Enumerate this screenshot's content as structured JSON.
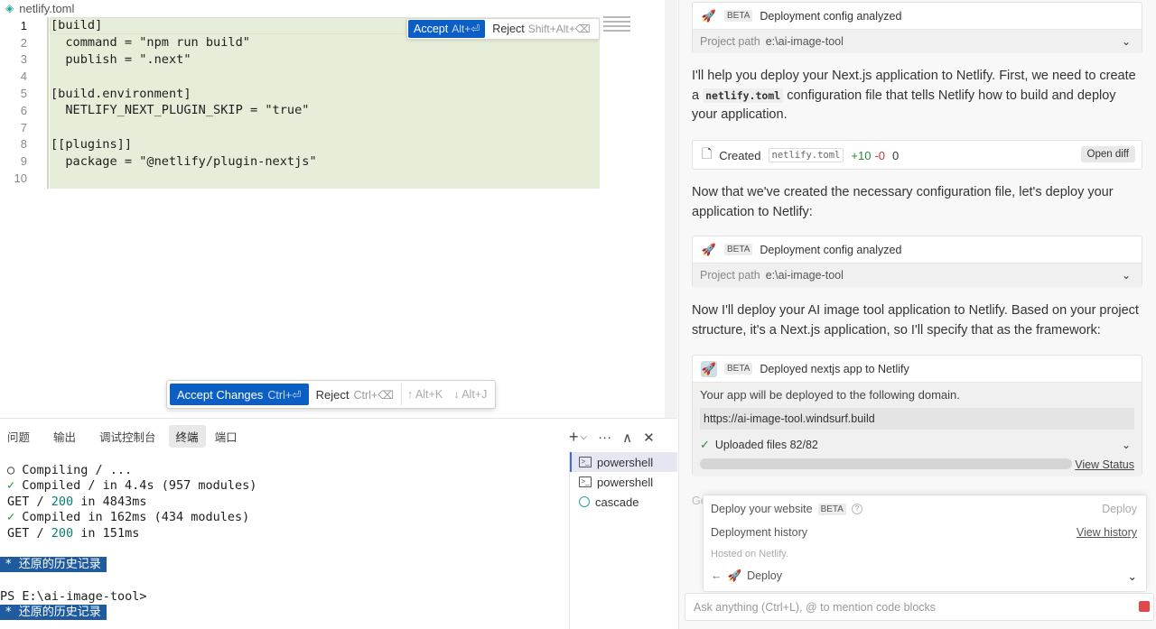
{
  "editor": {
    "filename": "netlify.toml",
    "lines": [
      {
        "num": "1",
        "text": "[build]"
      },
      {
        "num": "2",
        "text": "  command = \"npm run build\""
      },
      {
        "num": "3",
        "text": "  publish = \".next\""
      },
      {
        "num": "4",
        "text": ""
      },
      {
        "num": "5",
        "text": "[build.environment]"
      },
      {
        "num": "6",
        "text": "  NETLIFY_NEXT_PLUGIN_SKIP = \"true\""
      },
      {
        "num": "7",
        "text": ""
      },
      {
        "num": "8",
        "text": "[[plugins]]"
      },
      {
        "num": "9",
        "text": "  package = \"@netlify/plugin-nextjs\""
      },
      {
        "num": "10",
        "text": ""
      }
    ],
    "inline_accept": "Accept",
    "inline_accept_kb": "Alt+⏎",
    "inline_reject": "Reject",
    "inline_reject_kb": "Shift+Alt+⌫",
    "accept_changes": "Accept Changes",
    "accept_changes_kb": "Ctrl+⏎",
    "reject": "Reject",
    "reject_kb": "Ctrl+⌫",
    "prev_kb": "↑ Alt+K",
    "next_kb": "↓ Alt+J"
  },
  "panel": {
    "tabs": [
      "问题",
      "输出",
      "调试控制台",
      "终端",
      "端口"
    ],
    "active_tab": "终端",
    "actions": {
      "add": "+",
      "split": "⌵",
      "more": "···",
      "maximize": "∧",
      "close": "✕"
    },
    "terminal_lines": [
      {
        "prefix": "○",
        "text": " Compiling / ..."
      },
      {
        "prefix": "✓",
        "text": " Compiled / in 4.4s (957 modules)"
      },
      {
        "get": "GET / ",
        "code": "200",
        "rest": " in 4843ms"
      },
      {
        "prefix": "✓",
        "text": " Compiled in 162ms (434 modules)"
      },
      {
        "get": "GET / ",
        "code": "200",
        "rest": " in 151ms"
      }
    ],
    "history_label": "*  还原的历史记录",
    "prompt": "PS E:\\ai-image-tool>",
    "terminals": [
      "powershell",
      "powershell",
      "cascade"
    ]
  },
  "chat": {
    "card1": {
      "badge": "BETA",
      "title": "Deployment config analyzed",
      "path_label": "Project path",
      "path_value": "e:\\ai-image-tool"
    },
    "msg1_a": "I'll help you deploy your Next.js application to Netlify. First, we need to create a ",
    "msg1_code": "netlify.toml",
    "msg1_b": " configuration file that tells Netlify how to build and deploy your application.",
    "file": {
      "action": "Created",
      "name": "netlify.toml",
      "plus": "+10",
      "minus": "-0",
      "zero": "0",
      "open_diff": "Open diff"
    },
    "msg2": "Now that we've created the necessary configuration file, let's deploy your application to Netlify:",
    "card2": {
      "badge": "BETA",
      "title": "Deployment config analyzed",
      "path_label": "Project path",
      "path_value": "e:\\ai-image-tool"
    },
    "msg3": "Now I'll deploy your AI image tool application to Netlify. Based on your project structure, it's a Next.js application, so I'll specify that as the framework:",
    "deploy": {
      "badge": "BETA",
      "title": "Deployed nextjs app to Netlify",
      "body": "Your app will be deployed to the following domain.",
      "domain": "https://ai-image-tool.windsurf.build",
      "uploaded": "Uploaded files 82/82",
      "view_status": "View Status"
    },
    "ge_text": "Ge",
    "popup": {
      "deploy_site": "Deploy your website",
      "beta": "BETA",
      "deploy_btn": "Deploy",
      "history": "Deployment history",
      "view_history": "View history",
      "hosted": "Hosted on Netlify.",
      "deploy_row": "Deploy"
    },
    "input_placeholder": "Ask anything (Ctrl+L), @ to mention code blocks"
  }
}
